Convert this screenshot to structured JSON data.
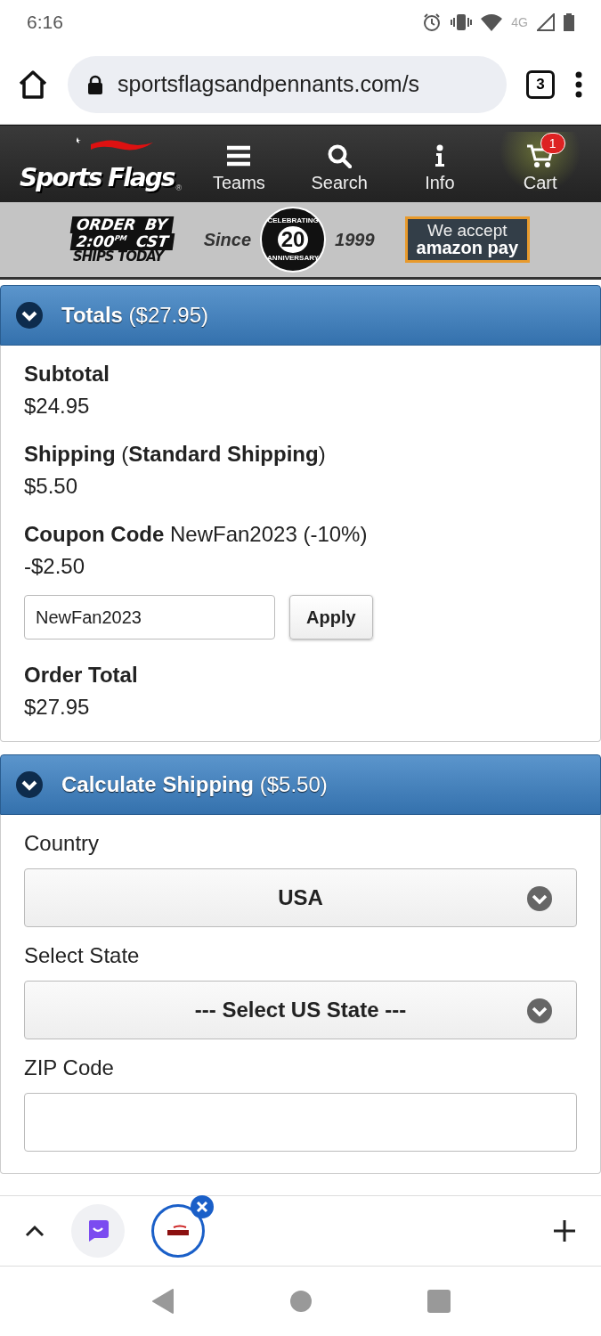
{
  "status_bar": {
    "time": "6:16",
    "network": "4G"
  },
  "browser": {
    "url": "sportsflagsandpennants.com/s",
    "tab_count": "3"
  },
  "site_header": {
    "logo": "Sports Flags",
    "logo_mark": "®",
    "nav": [
      {
        "label": "Teams",
        "kind": "menu",
        "selected": false
      },
      {
        "label": "Search",
        "kind": "search",
        "selected": false
      },
      {
        "label": "Info",
        "kind": "info",
        "selected": false
      },
      {
        "label": "Cart",
        "kind": "cart",
        "badge": "1",
        "selected": true
      }
    ]
  },
  "banner": {
    "order_by": "ORDER BY",
    "cutoff_time": "2:00$^{PM}$ CST",
    "ships": "SHIPS TODAY",
    "since": "Since",
    "seal_top": "CELEBRATING",
    "seal_number": "20",
    "seal_bottom": "ANNIVERSARY",
    "year": "1999",
    "payment_line1": "We accept",
    "payment_line2": "amazon pay"
  },
  "totals": {
    "title": "Totals",
    "amount": "($27.95)",
    "expanded": true,
    "lines": [
      {
        "label": "**Subtotal**",
        "value": "$24.95"
      },
      {
        "label": "**Shipping** (**Standard Shipping**)",
        "value": "$5.50"
      },
      {
        "label": "**Coupon Code** NewFan2023 (-10%)",
        "value": "-$2.50",
        "coupon": {
          "value": "NewFan2023",
          "button": "Apply"
        }
      },
      {
        "label": "**Order Total**",
        "value": "$27.95"
      }
    ]
  },
  "calculate_shipping": {
    "title": "Calculate Shipping",
    "amount": "($5.50)",
    "expanded": true,
    "fields": [
      {
        "kind": "select",
        "label": "Country",
        "value": "USA"
      },
      {
        "kind": "select",
        "label": "Select State",
        "value": "--- Select US State ---"
      },
      {
        "kind": "text",
        "label": "ZIP Code"
      }
    ]
  },
  "tab_group": {
    "tabs": [
      {
        "selected": false
      },
      {
        "selected": true
      }
    ]
  }
}
